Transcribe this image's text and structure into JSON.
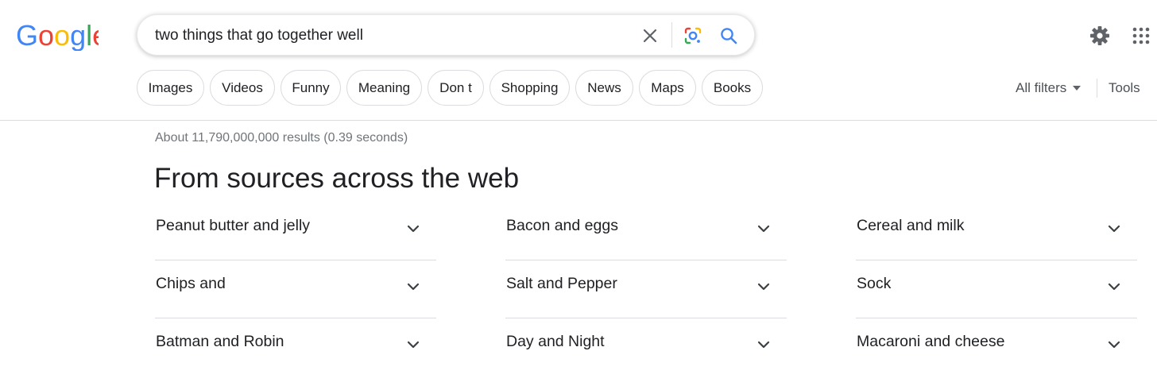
{
  "logo": {
    "text": "Google"
  },
  "search": {
    "query": "two things that go together well"
  },
  "icons": {
    "clear": "close-icon",
    "lens": "google-lens-icon",
    "search": "search-icon",
    "settings": "gear-icon",
    "apps": "apps-grid-icon",
    "expand": "chevron-down-icon"
  },
  "chips": [
    "Images",
    "Videos",
    "Funny",
    "Meaning",
    "Don t",
    "Shopping",
    "News",
    "Maps",
    "Books"
  ],
  "filters": {
    "all_filters": "All filters",
    "tools": "Tools"
  },
  "results": {
    "stats": "About 11,790,000,000 results (0.39 seconds)",
    "heading": "From sources across the web",
    "items": [
      [
        "Peanut butter and jelly",
        "Bacon and eggs",
        "Cereal and milk"
      ],
      [
        "Chips and",
        "Salt and Pepper",
        "Sock"
      ],
      [
        "Batman and Robin",
        "Day and Night",
        "Macaroni and cheese"
      ]
    ]
  },
  "colors": {
    "text": "#202124",
    "secondary_text": "#70757a",
    "border": "#dadce0",
    "google_blue": "#4285F4",
    "google_red": "#EA4335",
    "google_yellow": "#FBBC05",
    "google_green": "#34A853"
  }
}
